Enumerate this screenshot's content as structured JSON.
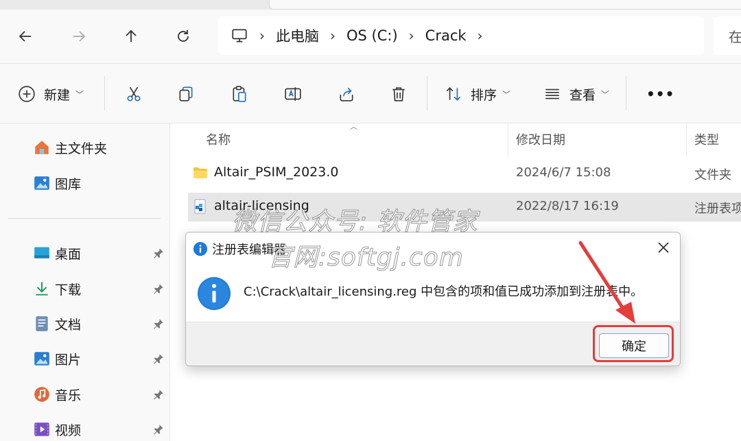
{
  "address_bar": {
    "crumbs": [
      "此电脑",
      "OS (C:)",
      "Crack"
    ],
    "search_hint": "在"
  },
  "toolbar": {
    "new_label": "新建",
    "sort_label": "排序",
    "view_label": "查看",
    "more_label": "•••"
  },
  "sidebar": {
    "items": [
      {
        "label": "主文件夹",
        "icon": "home-icon"
      },
      {
        "label": "图库",
        "icon": "gallery-icon"
      },
      {
        "label": "桌面",
        "icon": "desktop-icon",
        "pinned": true
      },
      {
        "label": "下载",
        "icon": "download-icon",
        "pinned": true
      },
      {
        "label": "文档",
        "icon": "document-icon",
        "pinned": true
      },
      {
        "label": "图片",
        "icon": "pictures-icon",
        "pinned": true
      },
      {
        "label": "音乐",
        "icon": "music-icon",
        "pinned": true
      },
      {
        "label": "视频",
        "icon": "video-icon",
        "pinned": true
      }
    ]
  },
  "file_list": {
    "columns": [
      "名称",
      "修改日期",
      "类型"
    ],
    "rows": [
      {
        "name": "Altair_PSIM_2023.0",
        "date": "2024/6/7 15:08",
        "type": "文件夹",
        "icon": "folder-icon"
      },
      {
        "name": "altair-licensing",
        "date": "2022/8/17 16:19",
        "type": "注册表项",
        "icon": "registry-file-icon"
      }
    ]
  },
  "watermark": {
    "line1": "微信公众号: 软件管家",
    "line2": "官网:softgj.com"
  },
  "dialog": {
    "title": "注册表编辑器",
    "message": "C:\\Crack\\altair_licensing.reg 中包含的项和值已成功添加到注册表中。",
    "ok_label": "确定"
  },
  "colors": {
    "highlight_red": "#e53c3c",
    "info_blue": "#1f7ad6",
    "folder_yellow": "#f4c542"
  }
}
